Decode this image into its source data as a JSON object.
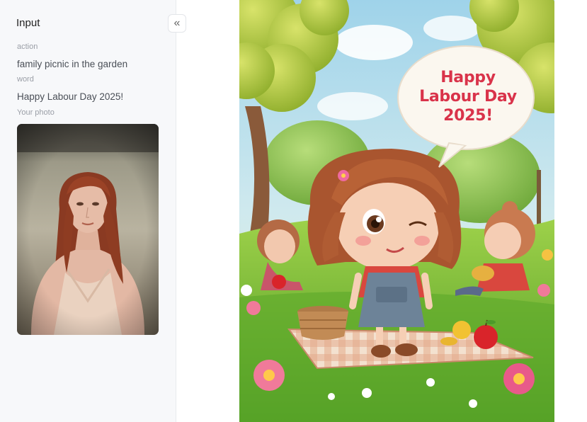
{
  "sidebar": {
    "title": "Input",
    "fields": [
      {
        "label": "action",
        "value": "family picnic in the garden"
      },
      {
        "label": "word",
        "value": "Happy Labour Day 2025!"
      },
      {
        "label": "Your photo"
      }
    ],
    "collapse_icon": "double-chevron-left-icon"
  },
  "result": {
    "bubble_lines": [
      "Happy",
      "Labour Day",
      "2025!"
    ]
  },
  "colors": {
    "sidebar_bg": "#f7f8fa",
    "bubble_text": "#d9334a"
  }
}
